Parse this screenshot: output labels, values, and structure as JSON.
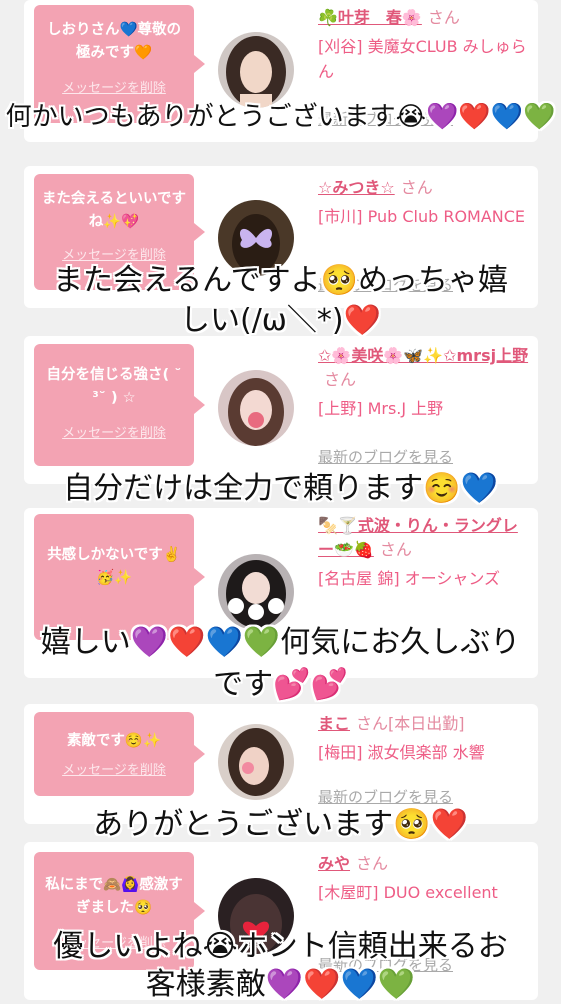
{
  "delete_label": "メッセージを削除",
  "blog_label": "最新のブログを見る",
  "san_label": "さん",
  "colors": {
    "bubble": "#f3a3b3",
    "name": "#e0587a",
    "shop": "#ee5d86",
    "background": "#f0f0f0"
  },
  "cards": [
    {
      "message": "しおりさん💙尊敬の極みです🧡",
      "name": "☘️叶芽　春🌸",
      "extra": "",
      "shop": "[刈谷] 美魔女CLUB みしゅらん",
      "avatar_icon": "woman-portrait-icon"
    },
    {
      "message": "また会えるといいですね✨💖",
      "name": "☆みつき☆",
      "extra": "",
      "shop": "[市川] Pub Club ROMANCE",
      "avatar_icon": "butterfly-portrait-icon"
    },
    {
      "message": "自分を信じる強さ( ˘ ³˘ ) ☆",
      "name": "✩🌸美咲🌸🦋✨✩mrsj上野",
      "extra": "",
      "shop": "[上野] Mrs.J 上野",
      "avatar_icon": "woman-portrait-icon"
    },
    {
      "message": "共感しかないです✌️🥳✨",
      "name": "🍢🍸式波・りん・ラングレー🥗🍓",
      "extra": "",
      "shop": "[名古屋 錦] オーシャンズ",
      "avatar_icon": "rin-portrait-icon"
    },
    {
      "message": "素敵です☺️✨",
      "name": "まこ",
      "extra": "[本日出勤]",
      "shop": "[梅田] 淑女倶楽部 水響",
      "avatar_icon": "woman-portrait-icon"
    },
    {
      "message": "私にまで🙈🙆‍♀️感激すぎました🥺",
      "name": "みや",
      "extra": "",
      "shop": "[木屋町] DUO excellent",
      "avatar_icon": "heart-portrait-icon"
    }
  ],
  "captions": [
    "何かいつもありがとうございます😭💜❤️💙💚",
    "また会えるんですよ🥺めっちゃ嬉",
    "しい(/ω＼*)❤️",
    "自分だけは全力で頼ります☺️💙",
    "嬉しい💜❤️💙💚何気にお久しぶり",
    "です💕💕",
    "ありがとうございます🥺❤️",
    "優しいよね😭ホント信頼出来るお",
    "客様素敵💜❤️💙💚"
  ]
}
